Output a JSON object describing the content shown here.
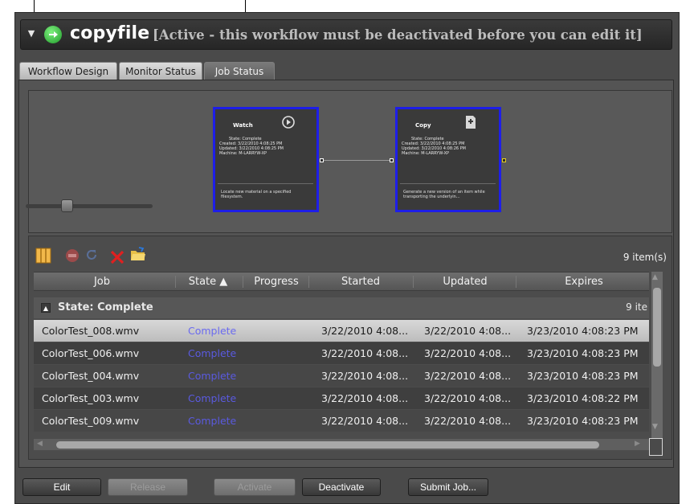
{
  "header": {
    "workflow_name": "copyfile",
    "status_text": "[Active - this workflow must be deactivated before you can edit it]"
  },
  "tabs": [
    {
      "label": "Workflow Design",
      "active": false
    },
    {
      "label": "Monitor Status",
      "active": false
    },
    {
      "label": "Job Status",
      "active": true
    }
  ],
  "designer": {
    "nodes": [
      {
        "title": "Watch",
        "icon": "watch-icon",
        "state": "State: Complete",
        "created": "Created: 3/22/2010 4:08:25 PM",
        "updated": "Updated: 3/22/2010 4:08:25 PM",
        "machine": "Machine: M-LARRYW-XP",
        "description": "Locate new material on a specified filesystem."
      },
      {
        "title": "Copy",
        "icon": "copy-icon",
        "state": "State: Complete",
        "created": "Created: 3/22/2010 4:08:25 PM",
        "updated": "Updated: 3/22/2010 4:08:26 PM",
        "machine": "Machine: M-LARRYW-XP",
        "description": "Generate a new version of an item while transporting the underlyin..."
      }
    ],
    "zoom_level": 0.2
  },
  "jobs": {
    "toolbar": [
      "columns-icon",
      "stop-icon",
      "refresh-icon",
      "delete-icon",
      "open-folder-icon"
    ],
    "item_count": "9 item(s)",
    "columns": {
      "job": "Job",
      "state": "State ▲",
      "progress": "Progress",
      "started": "Started",
      "updated": "Updated",
      "expires": "Expires"
    },
    "group": {
      "label": "State: Complete",
      "count": "9 ite"
    },
    "rows": [
      {
        "job": "ColorTest_008.wmv",
        "state": "Complete",
        "progress": "",
        "started": "3/22/2010 4:08...",
        "updated": "3/22/2010 4:08...",
        "expires": "3/23/2010 4:08:23 PM"
      },
      {
        "job": "ColorTest_006.wmv",
        "state": "Complete",
        "progress": "",
        "started": "3/22/2010 4:08...",
        "updated": "3/22/2010 4:08...",
        "expires": "3/23/2010 4:08:23 PM"
      },
      {
        "job": "ColorTest_004.wmv",
        "state": "Complete",
        "progress": "",
        "started": "3/22/2010 4:08...",
        "updated": "3/22/2010 4:08...",
        "expires": "3/23/2010 4:08:23 PM"
      },
      {
        "job": "ColorTest_003.wmv",
        "state": "Complete",
        "progress": "",
        "started": "3/22/2010 4:08...",
        "updated": "3/22/2010 4:08...",
        "expires": "3/23/2010 4:08:22 PM"
      },
      {
        "job": "ColorTest_009.wmv",
        "state": "Complete",
        "progress": "",
        "started": "3/22/2010 4:08...",
        "updated": "3/22/2010 4:08...",
        "expires": "3/23/2010 4:08:23 PM"
      }
    ]
  },
  "footer": {
    "edit": "Edit",
    "release": "Release",
    "activate": "Activate",
    "deactivate": "Deactivate",
    "submit_job": "Submit Job..."
  },
  "colors": {
    "node_border": "#1e1ee8",
    "state_complete": "#5a5ae0",
    "go_icon": "#2fbf3a"
  }
}
